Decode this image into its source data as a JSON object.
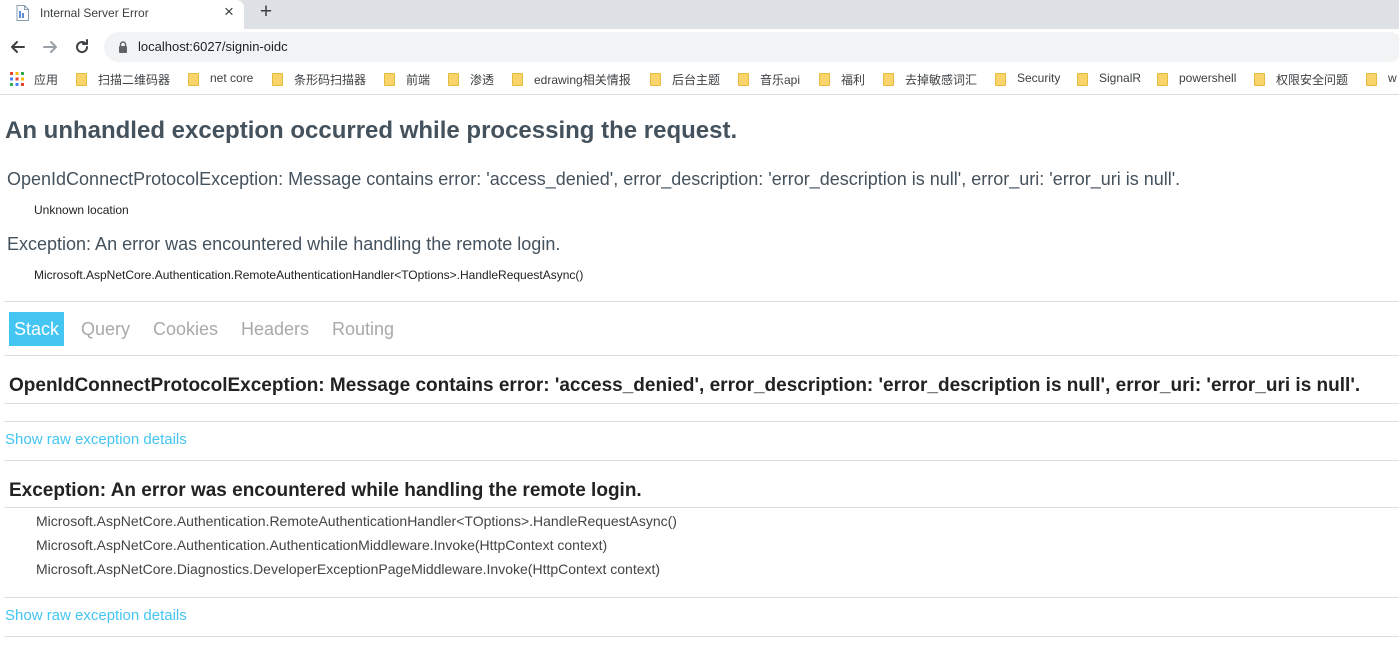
{
  "browser": {
    "tab_title": "Internal Server Error",
    "tab_close": "×",
    "new_tab": "+",
    "url": "localhost:6027/signin-oidc",
    "apps_label": "应用",
    "bookmarks": [
      {
        "label": "扫描二维码器"
      },
      {
        "label": "net core"
      },
      {
        "label": "条形码扫描器"
      },
      {
        "label": "前端"
      },
      {
        "label": "渗透"
      },
      {
        "label": "edrawing相关情报"
      },
      {
        "label": "后台主题"
      },
      {
        "label": "音乐api"
      },
      {
        "label": "福利"
      },
      {
        "label": "去掉敏感词汇"
      },
      {
        "label": "Security"
      },
      {
        "label": "SignalR"
      },
      {
        "label": "powershell"
      },
      {
        "label": "权限安全问题"
      },
      {
        "label": "w"
      }
    ]
  },
  "page": {
    "title": "An unhandled exception occurred while processing the request.",
    "summary": [
      {
        "message": "OpenIdConnectProtocolException: Message contains error: 'access_denied', error_description: 'error_description is null', error_uri: 'error_uri is null'.",
        "location": "Unknown location"
      },
      {
        "message": "Exception: An error was encountered while handling the remote login.",
        "location": "Microsoft.AspNetCore.Authentication.RemoteAuthenticationHandler<TOptions>.HandleRequestAsync()"
      }
    ],
    "tabs": [
      "Stack",
      "Query",
      "Cookies",
      "Headers",
      "Routing"
    ],
    "active_tab": "Stack",
    "exceptions": [
      {
        "title": "OpenIdConnectProtocolException: Message contains error: 'access_denied', error_description: 'error_description is null', error_uri: 'error_uri is null'.",
        "frames": [],
        "raw_link": "Show raw exception details"
      },
      {
        "title": "Exception: An error was encountered while handling the remote login.",
        "frames": [
          "Microsoft.AspNetCore.Authentication.RemoteAuthenticationHandler<TOptions>.HandleRequestAsync()",
          "Microsoft.AspNetCore.Authentication.AuthenticationMiddleware.Invoke(HttpContext context)",
          "Microsoft.AspNetCore.Diagnostics.DeveloperExceptionPageMiddleware.Invoke(HttpContext context)"
        ],
        "raw_link": "Show raw exception details"
      }
    ]
  },
  "colors": {
    "accent": "#44c5f2",
    "heading": "#44525e",
    "folder": "#f9d46b"
  }
}
